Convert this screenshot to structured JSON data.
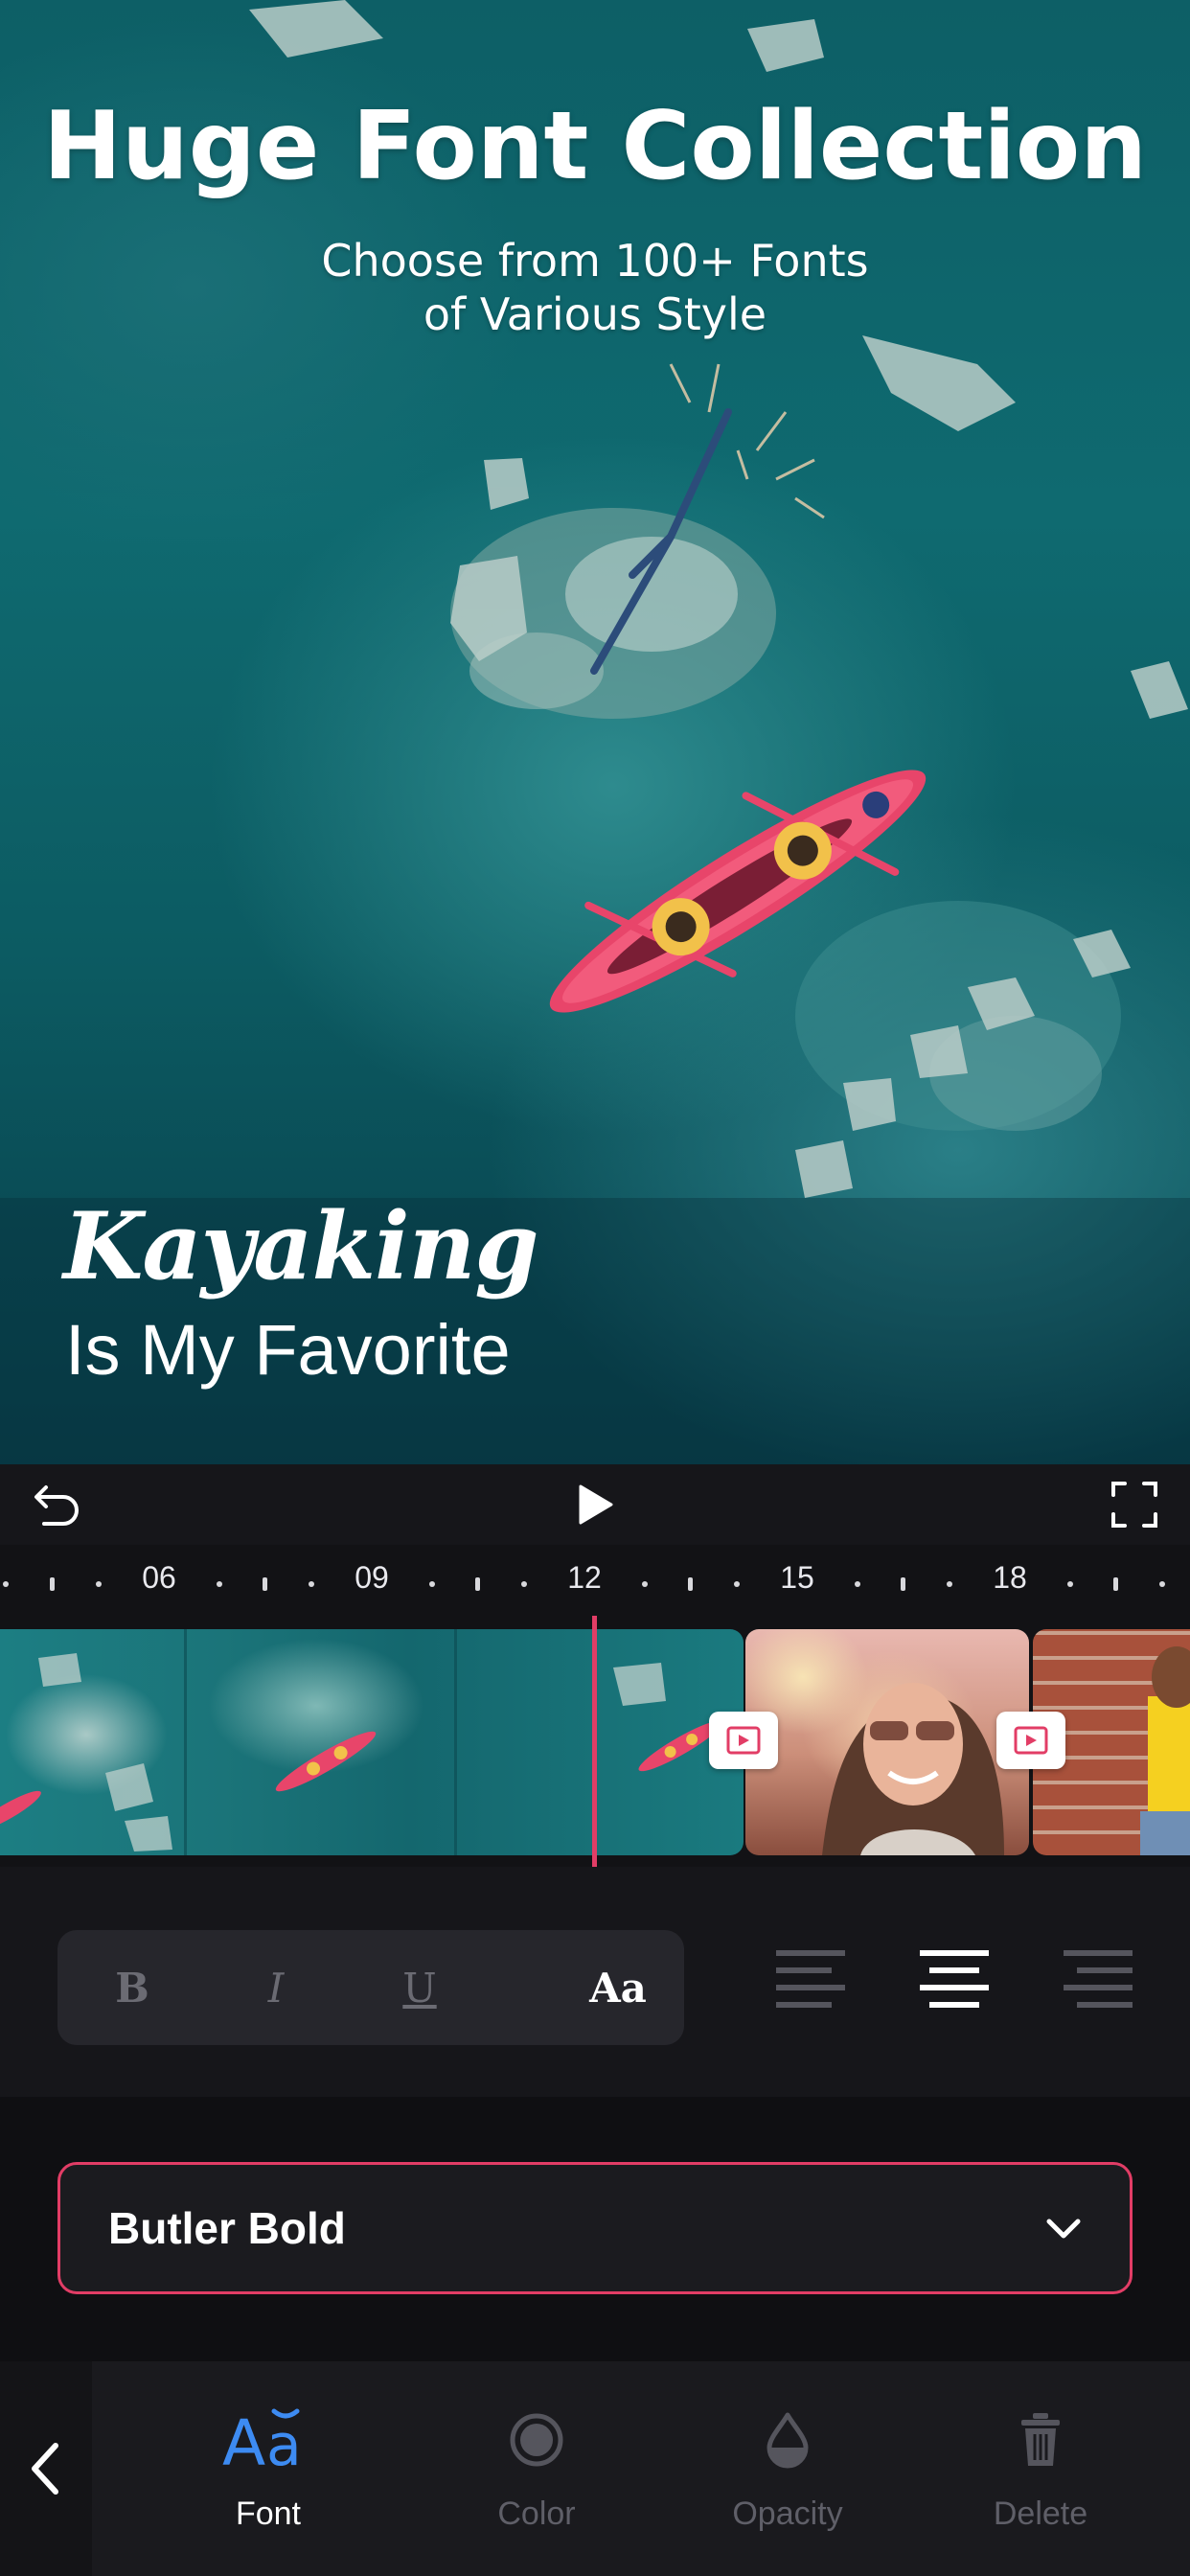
{
  "promo": {
    "title": "Huge Font Collection",
    "subtitle_line1": "Choose from 100+ Fonts",
    "subtitle_line2": "of Various Style"
  },
  "canvas_text": {
    "title": "Kayaking",
    "subtitle": "Is My Favorite"
  },
  "playback": {
    "undo_icon": "undo-icon",
    "play_icon": "play-icon",
    "fullscreen_icon": "fullscreen-icon"
  },
  "ruler": {
    "labels": [
      "06",
      "09",
      "12",
      "15",
      "18"
    ]
  },
  "timeline": {
    "clips": [
      "kayak-clip",
      "woman-sunglasses-clip",
      "woman-brick-wall-clip"
    ],
    "transition_icon": "transition-icon"
  },
  "format": {
    "bold": "B",
    "italic": "I",
    "underline": "U",
    "case": "Aa",
    "active_alignment": "center"
  },
  "font_picker": {
    "selected": "Butler Bold",
    "chevron_icon": "chevron-down-icon"
  },
  "toolbar": {
    "back_icon": "chevron-left-icon",
    "tools": [
      {
        "label": "Font",
        "icon": "font-icon",
        "active": true
      },
      {
        "label": "Color",
        "icon": "color-icon",
        "active": false
      },
      {
        "label": "Opacity",
        "icon": "opacity-icon",
        "active": false
      },
      {
        "label": "Delete",
        "icon": "trash-icon",
        "active": false
      }
    ]
  },
  "colors": {
    "accent": "#E23D66",
    "active_tool": "#3D8BF2",
    "panel": "#16161A",
    "background": "#0F0F12"
  }
}
